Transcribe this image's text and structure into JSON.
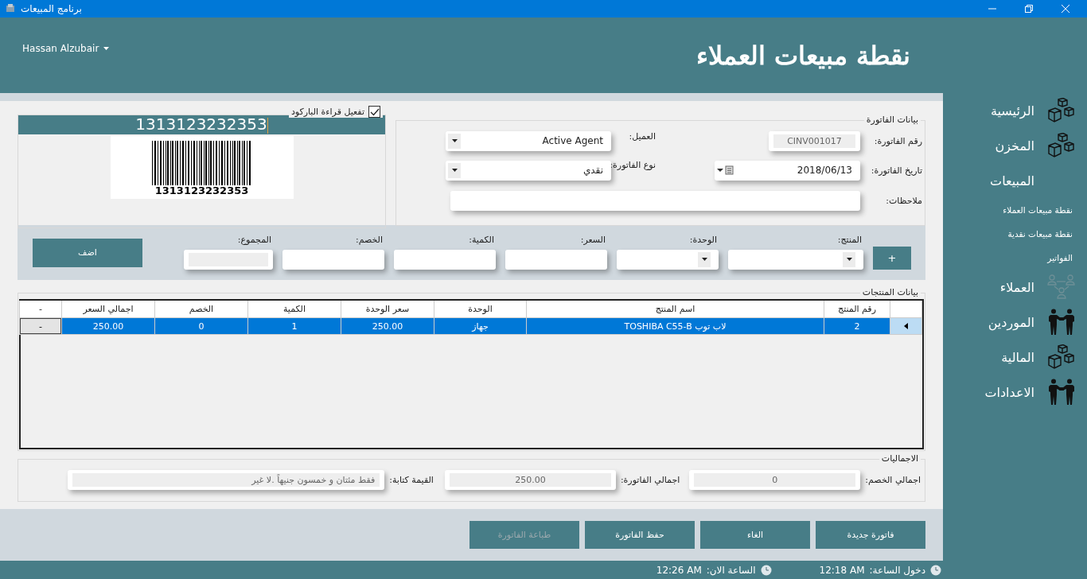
{
  "window": {
    "title": "برنامج المبيعات"
  },
  "header": {
    "user": "Hassan Alzubair",
    "title": "نقطة مبيعات العملاء"
  },
  "barcode": {
    "label": "تفعيل قراءة الباركود",
    "checked": true,
    "value": "1313123232353",
    "caption": "1313123232353"
  },
  "invoice": {
    "legend": "بيانات الفاتورة",
    "number": {
      "label": "رقم الفاتورة:",
      "value": "CINV001017"
    },
    "customer": {
      "label": "العميل:",
      "value": "Active Agent"
    },
    "date": {
      "label": "تاريخ الفاتورة:",
      "value": "2018/06/13"
    },
    "type": {
      "label": "نوع الفاتورة:",
      "value": "نقدي"
    },
    "notes": {
      "label": "ملاحظات:"
    }
  },
  "entry": {
    "plus": "+",
    "add": "اضف",
    "fields": [
      {
        "label": "المنتج:",
        "kind": "combo"
      },
      {
        "label": "الوحدة:",
        "kind": "combo"
      },
      {
        "label": "السعر:",
        "kind": "text"
      },
      {
        "label": "الكمية:",
        "kind": "text"
      },
      {
        "label": "الخصم:",
        "kind": "text"
      },
      {
        "label": "المجموع:",
        "kind": "readonly"
      }
    ]
  },
  "table": {
    "legend": "بيانات المنتجات",
    "columns": [
      "رقم المنتج",
      "اسم المنتج",
      "الوحدة",
      "سعر الوحدة",
      "الكمية",
      "الخصم",
      "اجمالي السعر",
      "-"
    ],
    "rows": [
      {
        "cells": [
          "2",
          "لاب توب TOSHIBA C55-B",
          "جهاز",
          "250.00",
          "1",
          "0",
          "250.00"
        ],
        "action": "-",
        "selected": true
      }
    ]
  },
  "totals": {
    "legend": "الاجماليات",
    "fields": [
      {
        "label": "اجمالي الخصم:",
        "value": "0"
      },
      {
        "label": "اجمالي الفاتورة:",
        "value": "250.00"
      },
      {
        "label": "القيمة كتابة:",
        "value": "فقط مئتان و خمسون جنيهاً .لا غير"
      }
    ]
  },
  "buttons": [
    {
      "label": "فاتورة جديدة",
      "disabled": false
    },
    {
      "label": "الغاء",
      "disabled": false
    },
    {
      "label": "حفظ الفاتورة",
      "disabled": false
    },
    {
      "label": "طباعة الفاتورة",
      "disabled": true
    }
  ],
  "sidebar": {
    "items": [
      {
        "label": "الرئيسية",
        "kind": "boxes"
      },
      {
        "label": "المخزن",
        "kind": "boxes"
      },
      {
        "label": "المبيعات",
        "kind": "none",
        "children": [
          {
            "label": "نقطة مبيعات العملاء"
          },
          {
            "label": "نقطة مبيعات نقدية"
          },
          {
            "label": "الفواتير"
          }
        ]
      },
      {
        "label": "العملاء",
        "kind": "people"
      },
      {
        "label": "الموردين",
        "kind": "handshake"
      },
      {
        "label": "المالية",
        "kind": "boxes"
      },
      {
        "label": "الاعدادات",
        "kind": "handshake"
      }
    ]
  },
  "status_bar": [
    {
      "label": "دخول الساعة:",
      "value": "12:18 AM"
    },
    {
      "label": "الساعة الان:",
      "value": "12:26 AM"
    }
  ]
}
